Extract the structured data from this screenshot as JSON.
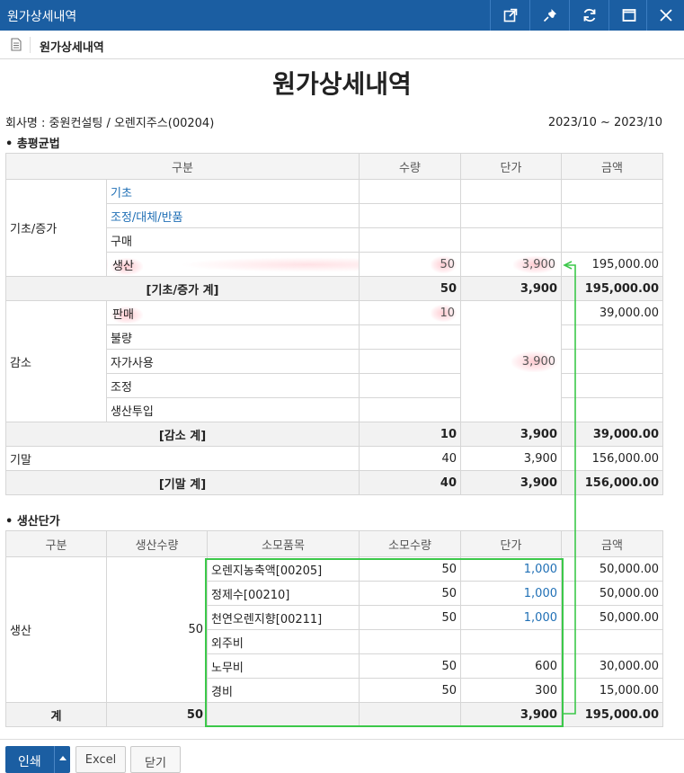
{
  "window": {
    "title": "원가상세내역",
    "buttons": [
      "popout-icon",
      "pin-icon",
      "refresh-icon",
      "maximize-icon",
      "close-icon"
    ]
  },
  "tab": {
    "label": "원가상세내역"
  },
  "report": {
    "title": "원가상세내역",
    "company": "회사명 : 중원컨설팅 / 오렌지주스(00204)",
    "period": "2023/10 ~ 2023/10"
  },
  "section1": {
    "title": "• 총평균법",
    "headers": {
      "category": "구분",
      "qty": "수량",
      "price": "단가",
      "amount": "금액"
    },
    "group_open": "기초/증가",
    "rows_open": [
      {
        "label": "기초",
        "qty": "",
        "price": "",
        "amount": ""
      },
      {
        "label": "조정/대체/반품",
        "qty": "",
        "price": "",
        "amount": ""
      },
      {
        "label": "구매",
        "qty": "",
        "price": "",
        "amount": ""
      },
      {
        "label": "생산",
        "qty": "50",
        "price": "3,900",
        "amount": "195,000.00"
      }
    ],
    "sum_open": {
      "label": "[기초/증가 계]",
      "qty": "50",
      "price": "3,900",
      "amount": "195,000.00"
    },
    "group_dec": "감소",
    "rows_dec": [
      {
        "label": "판매",
        "qty": "10",
        "amount": "39,000.00"
      },
      {
        "label": "불량",
        "qty": "",
        "amount": ""
      },
      {
        "label": "자가사용",
        "qty": "",
        "amount": ""
      },
      {
        "label": "조정",
        "qty": "",
        "amount": ""
      },
      {
        "label": "생산투입",
        "qty": "",
        "amount": ""
      }
    ],
    "dec_price": "3,900",
    "sum_dec": {
      "label": "[감소 계]",
      "qty": "10",
      "price": "3,900",
      "amount": "39,000.00"
    },
    "row_end": {
      "label": "기말",
      "qty": "40",
      "price": "3,900",
      "amount": "156,000.00"
    },
    "sum_end": {
      "label": "[기말 계]",
      "qty": "40",
      "price": "3,900",
      "amount": "156,000.00"
    }
  },
  "section2": {
    "title": "• 생산단가",
    "headers": {
      "category": "구분",
      "prod_qty": "생산수량",
      "item": "소모품목",
      "used_qty": "소모수량",
      "price": "단가",
      "amount": "금액"
    },
    "category": "생산",
    "prod_qty": "50",
    "rows": [
      {
        "item": "오렌지농축액[00205]",
        "qty": "50",
        "price": "1,000",
        "amount": "50,000.00"
      },
      {
        "item": "정제수[00210]",
        "qty": "50",
        "price": "1,000",
        "amount": "50,000.00"
      },
      {
        "item": "천연오렌지향[00211]",
        "qty": "50",
        "price": "1,000",
        "amount": "50,000.00"
      },
      {
        "item": "외주비",
        "qty": "",
        "price": "",
        "amount": ""
      },
      {
        "item": "노무비",
        "qty": "50",
        "price": "600",
        "amount": "30,000.00"
      },
      {
        "item": "경비",
        "qty": "50",
        "price": "300",
        "amount": "15,000.00"
      }
    ],
    "total": {
      "label": "계",
      "prod_qty": "50",
      "price": "3,900",
      "amount": "195,000.00"
    }
  },
  "footer": {
    "print": "인쇄",
    "excel": "Excel",
    "close": "닫기"
  },
  "colors": {
    "titlebar": "#1b5ea2",
    "link": "#1f6fb5",
    "annotation": "#3cc84a"
  }
}
